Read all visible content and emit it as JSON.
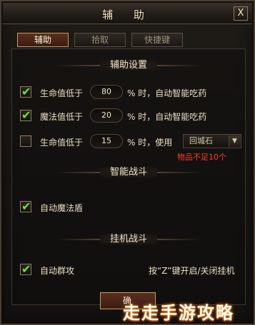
{
  "window": {
    "title": "辅 助",
    "close_label": "X"
  },
  "tabs": [
    {
      "label": "辅助",
      "active": true
    },
    {
      "label": "拾取",
      "active": false
    },
    {
      "label": "快捷键",
      "active": false
    }
  ],
  "sections": {
    "assist": "辅助设置",
    "smart_battle": "智能战斗",
    "afk_battle": "挂机战斗"
  },
  "rows": [
    {
      "checked": true,
      "label": "生命值低于",
      "value": "80",
      "suffix": "% 时，自动智能吃药"
    },
    {
      "checked": true,
      "label": "魔法值低于",
      "value": "20",
      "suffix": "% 时，自动智能吃药"
    },
    {
      "checked": false,
      "label": "生命值低于",
      "value": "15",
      "suffix": "% 时，使用",
      "item": "回城石",
      "warning": "物品不足10个"
    }
  ],
  "smart": {
    "checked": true,
    "label": "自动魔法盾"
  },
  "afk": {
    "checked": true,
    "label": "自动群攻",
    "hint": "按“Z”键开启/关闭挂机"
  },
  "footer": {
    "confirm_label": "确",
    "watermark": "走走手游攻略"
  },
  "colors": {
    "tick": "#74d650",
    "warning": "#ff3b2c",
    "accent": "#c29a5f"
  }
}
